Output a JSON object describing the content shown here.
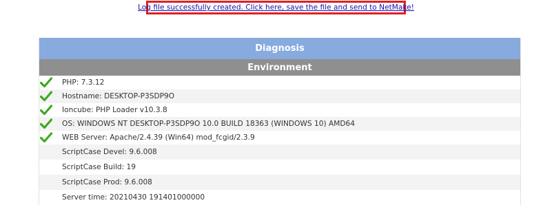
{
  "log_link": "Log file successfully created. Click here, save the file and send to NetMake!",
  "diagnosis": {
    "title": "Diagnosis",
    "section": "Environment",
    "rows": [
      {
        "text": "PHP: 7.3.12",
        "check": true
      },
      {
        "text": "Hostname: DESKTOP-P3SDP9O",
        "check": true
      },
      {
        "text": "Ioncube: PHP Loader v10.3.8",
        "check": true
      },
      {
        "text": "OS: WINDOWS NT DESKTOP-P3SDP9O 10.0 BUILD 18363 (WINDOWS 10) AMD64",
        "check": true
      },
      {
        "text": "WEB Server: Apache/2.4.39 (Win64) mod_fcgid/2.3.9",
        "check": true
      },
      {
        "text": "ScriptCase Devel: 9.6.008",
        "check": false
      },
      {
        "text": "ScriptCase Build: 19",
        "check": false
      },
      {
        "text": "ScriptCase Prod: 9.6.008",
        "check": false
      },
      {
        "text": "Server time: 20210430 191401000000",
        "check": false
      }
    ]
  },
  "colors": {
    "title_bar": "#87aadf",
    "section_bar": "#8f8f8f",
    "check": "#3caa1e",
    "highlight_border": "#e02020"
  },
  "icons": {
    "check": "checkmark-icon"
  }
}
